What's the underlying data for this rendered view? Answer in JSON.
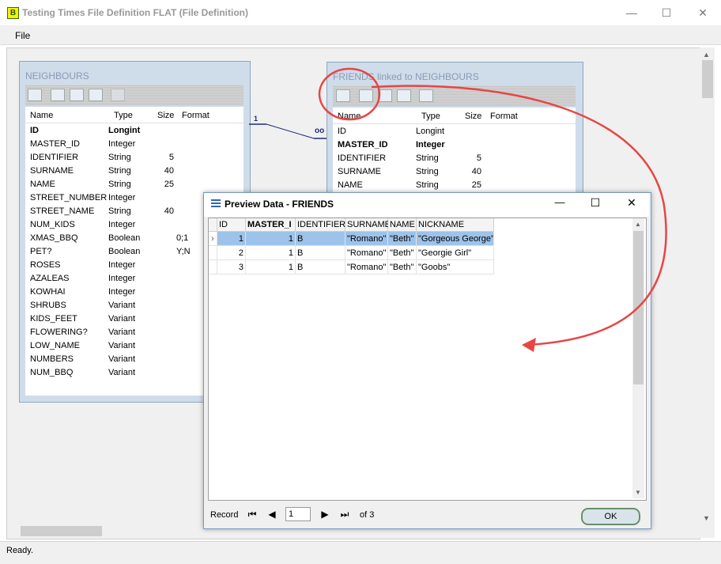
{
  "window": {
    "title": "Testing Times File Definition FLAT (File Definition)",
    "icon_letter": "B",
    "minimize_glyph": "—",
    "maximize_glyph": "☐",
    "close_glyph": "✕"
  },
  "menu": {
    "file": "File"
  },
  "status": "Ready.",
  "neighbours": {
    "title": "NEIGHBOURS",
    "headers": {
      "name": "Name",
      "type": "Type",
      "size": "Size",
      "format": "Format"
    },
    "rows": [
      {
        "name": "ID",
        "type": "Longint",
        "size": "",
        "format": "",
        "bold": true
      },
      {
        "name": "MASTER_ID",
        "type": "Integer",
        "size": "",
        "format": ""
      },
      {
        "name": "IDENTIFIER",
        "type": "String",
        "size": "5",
        "format": ""
      },
      {
        "name": "SURNAME",
        "type": "String",
        "size": "40",
        "format": ""
      },
      {
        "name": "NAME",
        "type": "String",
        "size": "25",
        "format": ""
      },
      {
        "name": "STREET_NUMBER",
        "type": "Integer",
        "size": "",
        "format": ""
      },
      {
        "name": "STREET_NAME",
        "type": "String",
        "size": "40",
        "format": ""
      },
      {
        "name": "NUM_KIDS",
        "type": "Integer",
        "size": "",
        "format": ""
      },
      {
        "name": "XMAS_BBQ",
        "type": "Boolean",
        "size": "",
        "format": "0;1"
      },
      {
        "name": "PET?",
        "type": "Boolean",
        "size": "",
        "format": "Y;N"
      },
      {
        "name": "ROSES",
        "type": "Integer",
        "size": "",
        "format": ""
      },
      {
        "name": "AZALEAS",
        "type": "Integer",
        "size": "",
        "format": ""
      },
      {
        "name": "KOWHAI",
        "type": "Integer",
        "size": "",
        "format": ""
      },
      {
        "name": "SHRUBS",
        "type": "Variant",
        "size": "",
        "format": ""
      },
      {
        "name": "KIDS_FEET",
        "type": "Variant",
        "size": "",
        "format": ""
      },
      {
        "name": "FLOWERING?",
        "type": "Variant",
        "size": "",
        "format": ""
      },
      {
        "name": "LOW_NAME",
        "type": "Variant",
        "size": "",
        "format": ""
      },
      {
        "name": "NUMBERS",
        "type": "Variant",
        "size": "",
        "format": ""
      },
      {
        "name": "NUM_BBQ",
        "type": "Variant",
        "size": "",
        "format": ""
      }
    ]
  },
  "friends": {
    "title": "FRIENDS linked to NEIGHBOURS",
    "headers": {
      "name": "Name",
      "type": "Type",
      "size": "Size",
      "format": "Format"
    },
    "rows": [
      {
        "name": "ID",
        "type": "Longint",
        "size": "",
        "format": ""
      },
      {
        "name": "MASTER_ID",
        "type": "Integer",
        "size": "",
        "format": "",
        "bold": true
      },
      {
        "name": "IDENTIFIER",
        "type": "String",
        "size": "5",
        "format": ""
      },
      {
        "name": "SURNAME",
        "type": "String",
        "size": "40",
        "format": ""
      },
      {
        "name": "NAME",
        "type": "String",
        "size": "25",
        "format": ""
      }
    ]
  },
  "link": {
    "one": "1",
    "many": "oo"
  },
  "preview": {
    "title": "Preview Data - FRIENDS",
    "columns": [
      "ID",
      "MASTER_I",
      "IDENTIFIER",
      "SURNAME",
      "NAME",
      "NICKNAME"
    ],
    "rows": [
      [
        "1",
        "1",
        "B",
        "\"Romano\"",
        "\"Beth\"",
        "\"Gorgeous George\""
      ],
      [
        "2",
        "1",
        "B",
        "\"Romano\"",
        "\"Beth\"",
        "\"Georgie Girl\""
      ],
      [
        "3",
        "1",
        "B",
        "\"Romano\"",
        "\"Beth\"",
        "\"Goobs\""
      ]
    ],
    "nav": {
      "record_label": "Record",
      "current": "1",
      "of_label": "of 3",
      "first": "⏮",
      "prev": "◀",
      "next": "▶",
      "last": "⏭"
    },
    "ok_label": "OK"
  },
  "colors": {
    "annotation": "#e84545",
    "selected": "#9dc3ea",
    "panel": "#cfdcea"
  }
}
